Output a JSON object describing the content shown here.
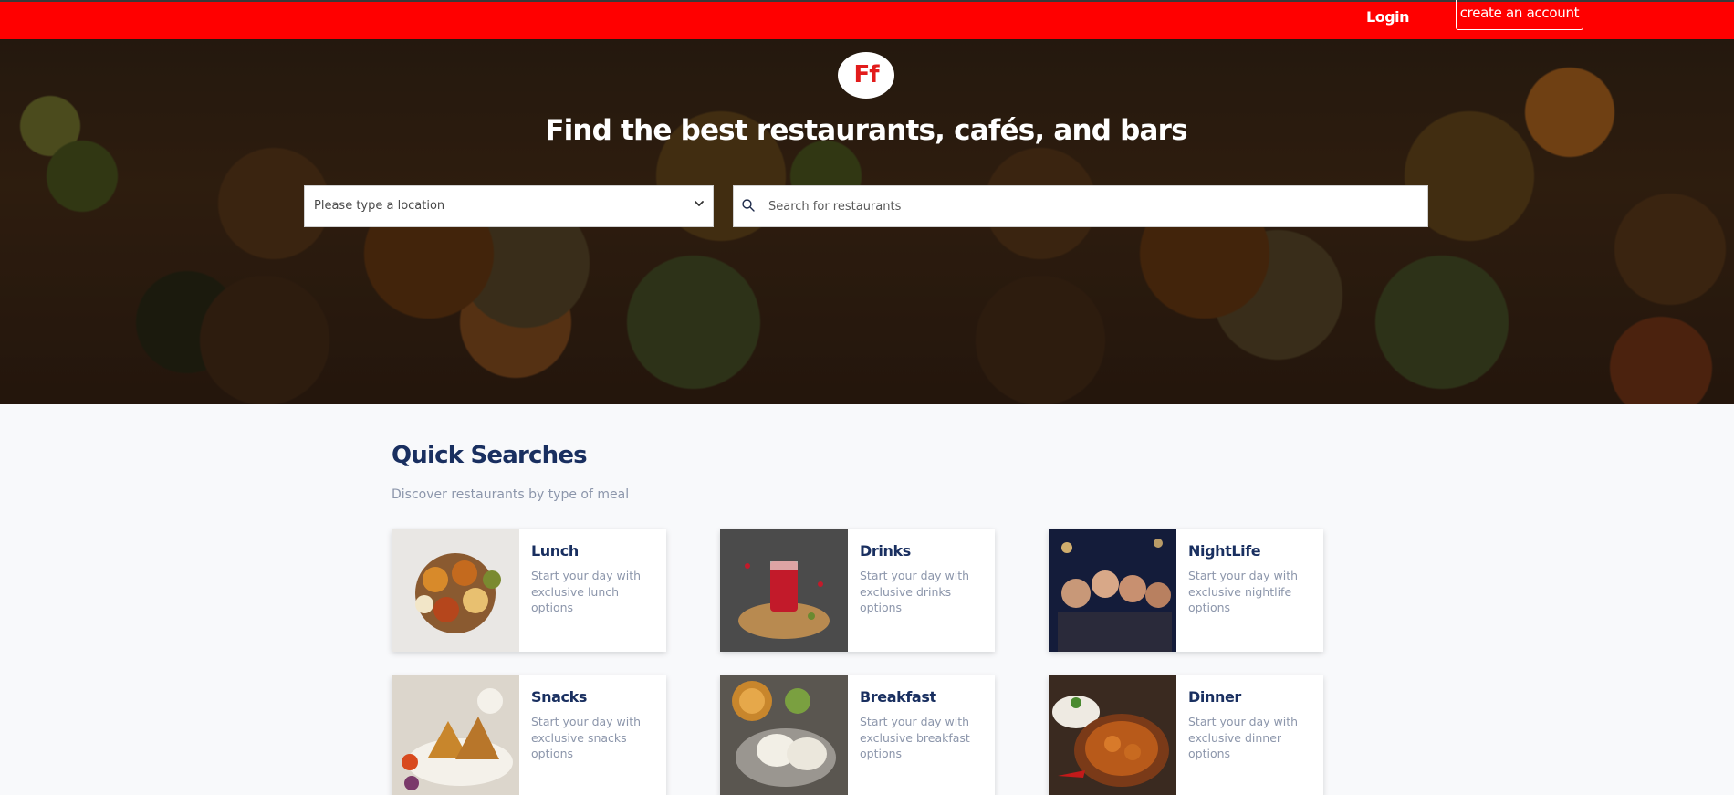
{
  "header": {
    "login_label": "Login",
    "create_account_label": "create an account"
  },
  "hero": {
    "logo_text": "Ff",
    "headline": "Find the best restaurants, cafés, and bars",
    "location_placeholder": "Please type a location",
    "search_placeholder": "Search for restaurants"
  },
  "quick_searches": {
    "title": "Quick Searches",
    "subtitle": "Discover restaurants by type of meal",
    "cards": [
      {
        "title": "Lunch",
        "desc": "Start your day with exclusive lunch options"
      },
      {
        "title": "Drinks",
        "desc": "Start your day with exclusive drinks options"
      },
      {
        "title": "NightLife",
        "desc": "Start your day with exclusive nightlife options"
      },
      {
        "title": "Snacks",
        "desc": "Start your day with exclusive snacks options"
      },
      {
        "title": "Breakfast",
        "desc": "Start your day with exclusive breakfast options"
      },
      {
        "title": "Dinner",
        "desc": "Start your day with exclusive dinner options"
      }
    ]
  },
  "colors": {
    "brand_red": "#ff0000",
    "heading_navy": "#192f60",
    "muted_text": "#8c96ab"
  },
  "icons": {
    "search": "search-icon",
    "dropdown": "chevron-down-icon"
  }
}
